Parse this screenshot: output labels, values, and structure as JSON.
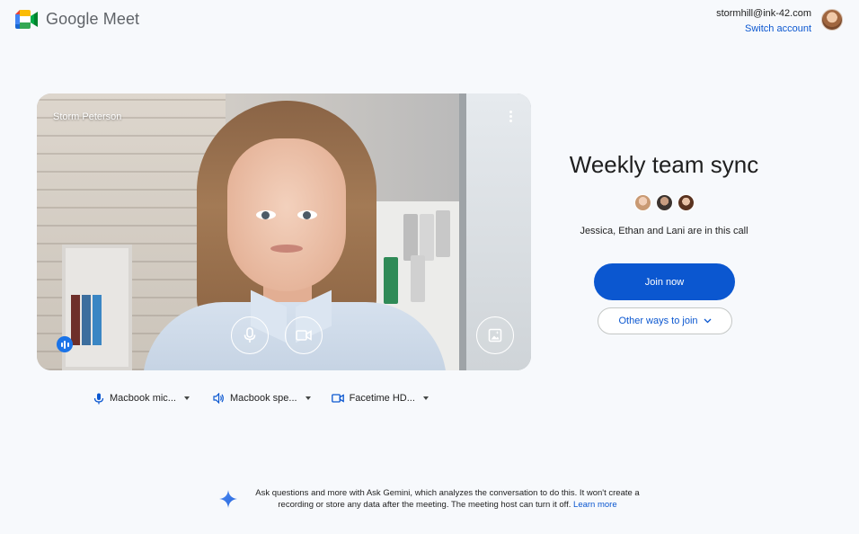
{
  "header": {
    "product_name": "Google Meet",
    "account_email": "stormhill@ink-42.com",
    "switch_account_label": "Switch account",
    "avatar_icon": "user-avatar"
  },
  "preview": {
    "user_name": "Storm Peterson",
    "more_icon": "more-vert-icon",
    "mic_icon": "mic-icon",
    "camera_icon": "videocam-icon",
    "effects_icon": "visual-effects-icon",
    "speaking_icon": "audio-level-icon"
  },
  "devices": [
    {
      "icon": "mic-icon",
      "label": "Macbook mic..."
    },
    {
      "icon": "speaker-icon",
      "label": "Macbook spe..."
    },
    {
      "icon": "videocam-icon",
      "label": "Facetime HD..."
    }
  ],
  "meeting": {
    "title": "Weekly team sync",
    "participants_text": "Jessica, Ethan and Lani are in this call",
    "join_label": "Join now",
    "other_ways_label": "Other ways to join"
  },
  "gemini": {
    "text": "Ask questions and more with Ask Gemini, which analyzes the conversation to do this. It won't create a recording or store any data after the meeting. The meeting host can turn it off.",
    "link_label": "Learn more"
  },
  "colors": {
    "accent": "#0b57d0",
    "background": "#f7f9fc",
    "speaking": "#1a73e8"
  }
}
